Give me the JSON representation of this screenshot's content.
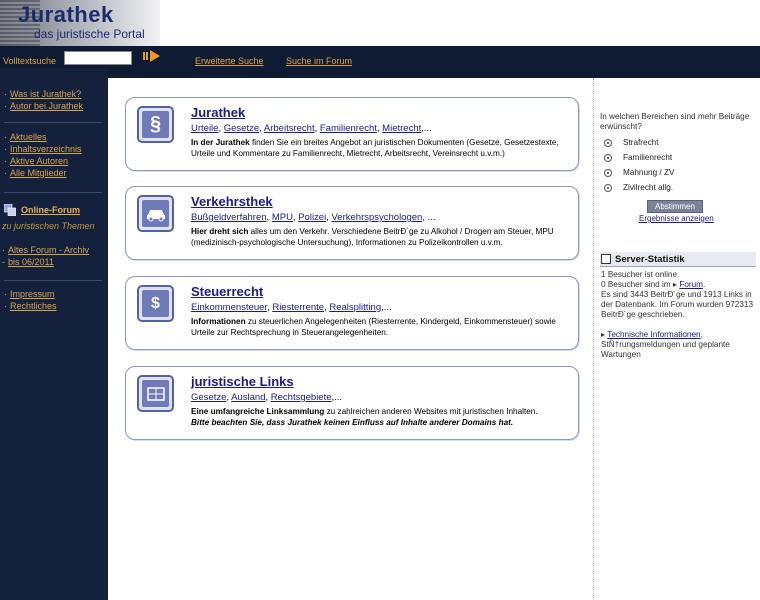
{
  "header": {
    "logo_title": "Jurathek",
    "logo_subtitle": "das juristische Portal"
  },
  "topbar": {
    "search_label": "Volltextsuche",
    "search_value": "",
    "advanced_search": "Erweiterte Suche",
    "forum_search": "Suche im Forum"
  },
  "sidebar": {
    "group1": [
      "Was ist Jurathek?",
      "Autor bei Jurathek"
    ],
    "group2": [
      "Aktuelles",
      "Inhaltsverzeichnis",
      "Aktive Autoren",
      "Alle Mitglieder"
    ],
    "forum_label": "Online-Forum",
    "forum_sub": "zu juristischen Themen",
    "forum_archiv": "Altes Forum - Archiv",
    "forum_archiv_date": "bis 06/2011",
    "group3": [
      "Impressum",
      "Rechtliches"
    ]
  },
  "cards": [
    {
      "title": "Jurathek",
      "icon": "paragraph-icon",
      "links": [
        "Urteile",
        "Gesetze",
        "Arbeitsrecht",
        "Familienrecht",
        "Mietrecht"
      ],
      "desc_bold": "In der Jurathek",
      "desc": " finden Sie ein breites Angebot an juristischen Dokumenten (Gesetze, Gesetzestexte, Urteile und Kommentare zu Familienrecht, Mietrecht, Arbeitsrecht, Vereinsrecht u.v.m.)"
    },
    {
      "title": "Verkehrsthek",
      "icon": "car-icon",
      "links": [
        "Bußgeldverfahren",
        "MPU",
        "Polizei",
        "Verkehrspsychologen"
      ],
      "desc_bold": "Hier dreht sich",
      "desc": " alles um den Verkehr. Verschiedene BeitrÐ´ge zu Alkohol / Drogen am Steuer, MPU (medizinisch-psychologische Untersuchung), Informationen zu Polizeikontrollen u.v.m."
    },
    {
      "title": "Steuerrecht",
      "icon": "money-bag-icon",
      "links": [
        "Einkommensteuer",
        "Riesterrente",
        "Realsplitting"
      ],
      "desc_bold": "Informationen",
      "desc": " zu steuerlichen Angelegenheiten (Riesterrente, Kindergeld, Einkommensteuer) sowie Urteile zur Rechtsprechung in Steuerangelegenheiten."
    },
    {
      "title": "juristische Links",
      "icon": "globe-icon",
      "links": [
        "Gesetze",
        "Ausland",
        "Rechtsgebiete"
      ],
      "desc_bold": "Eine umfangreiche Linksammlung",
      "desc": " zu zahlreichen anderen Websites mit juristischen Inhalten.",
      "desc_italic": "Bitte beachten Sie, dass Jurathek keinen Einfluss auf Inhalte anderer Domains hat."
    }
  ],
  "poll": {
    "question": "In welchen Bereichen sind mehr Beiträge erwünscht?",
    "options": [
      "Strafrecht",
      "Familienrecht",
      "Mahnung / ZV",
      "Zivilrecht allg."
    ],
    "vote_button": "Abstimmen",
    "results_link": "Ergebnisse anzeigen"
  },
  "stats": {
    "title": "Server-Statistik",
    "line1": "1 Besucher ist online.",
    "line2_pre": "0 Besucher sind im",
    "line2_link": "Forum",
    "line3": "Es sind 3443 BeitrÐ´ge und 1913 Links in der Datenbank. Im Forum wurden 972313 BeitrÐ´ge geschrieben.",
    "tech_link": "Technische Informationen",
    "tech_rest": "StÑ†rungsmeldungen und geplante Wartungen"
  },
  "colors": {
    "nav_bg": "#14213d",
    "nav_text": "#d9a54a",
    "card_border": "#8d97c7",
    "link": "#1a1a8c"
  }
}
